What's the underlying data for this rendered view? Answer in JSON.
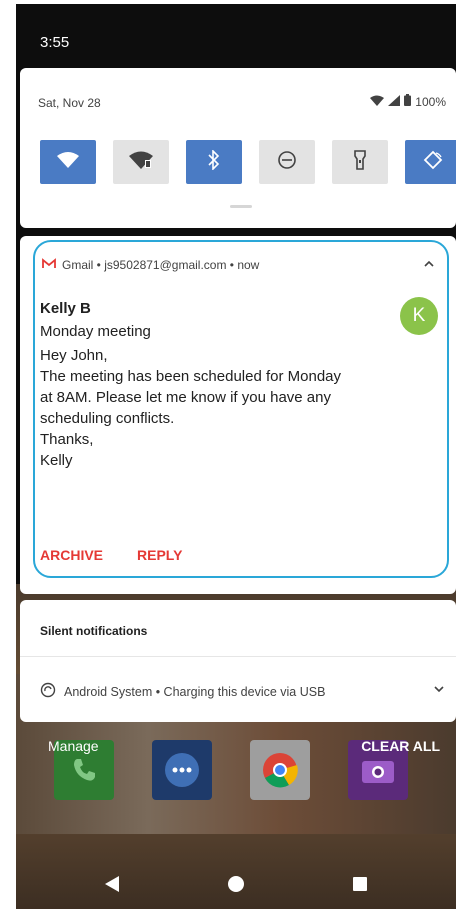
{
  "status_bar": {
    "time": "3:55"
  },
  "quick_settings": {
    "date": "Sat, Nov 28",
    "battery": "100%",
    "tiles": [
      {
        "name": "wifi",
        "state": "on"
      },
      {
        "name": "screen-cast",
        "state": "off"
      },
      {
        "name": "bluetooth",
        "state": "on"
      },
      {
        "name": "do-not-disturb",
        "state": "off"
      },
      {
        "name": "flashlight",
        "state": "off"
      },
      {
        "name": "auto-rotate",
        "state": "on"
      }
    ]
  },
  "notification": {
    "app_line": "Gmail • js9502871@gmail.com • now",
    "avatar_letter": "K",
    "sender": "Kelly B",
    "subject": "Monday meeting",
    "body_lines": [
      "Hey John,",
      "The meeting has been scheduled for Monday",
      "at 8AM. Please let me know if you have any",
      "scheduling conflicts.",
      "Thanks,",
      "Kelly"
    ],
    "actions": [
      "ARCHIVE",
      "REPLY"
    ],
    "colors": {
      "accent": "#e53935",
      "outline": "#2aa7d8",
      "avatar": "#8bc34a"
    }
  },
  "silent": {
    "title": "Silent notifications",
    "system_line": "Android System • Charging this device via USB"
  },
  "footer": {
    "manage": "Manage",
    "clear_all": "CLEAR ALL"
  }
}
